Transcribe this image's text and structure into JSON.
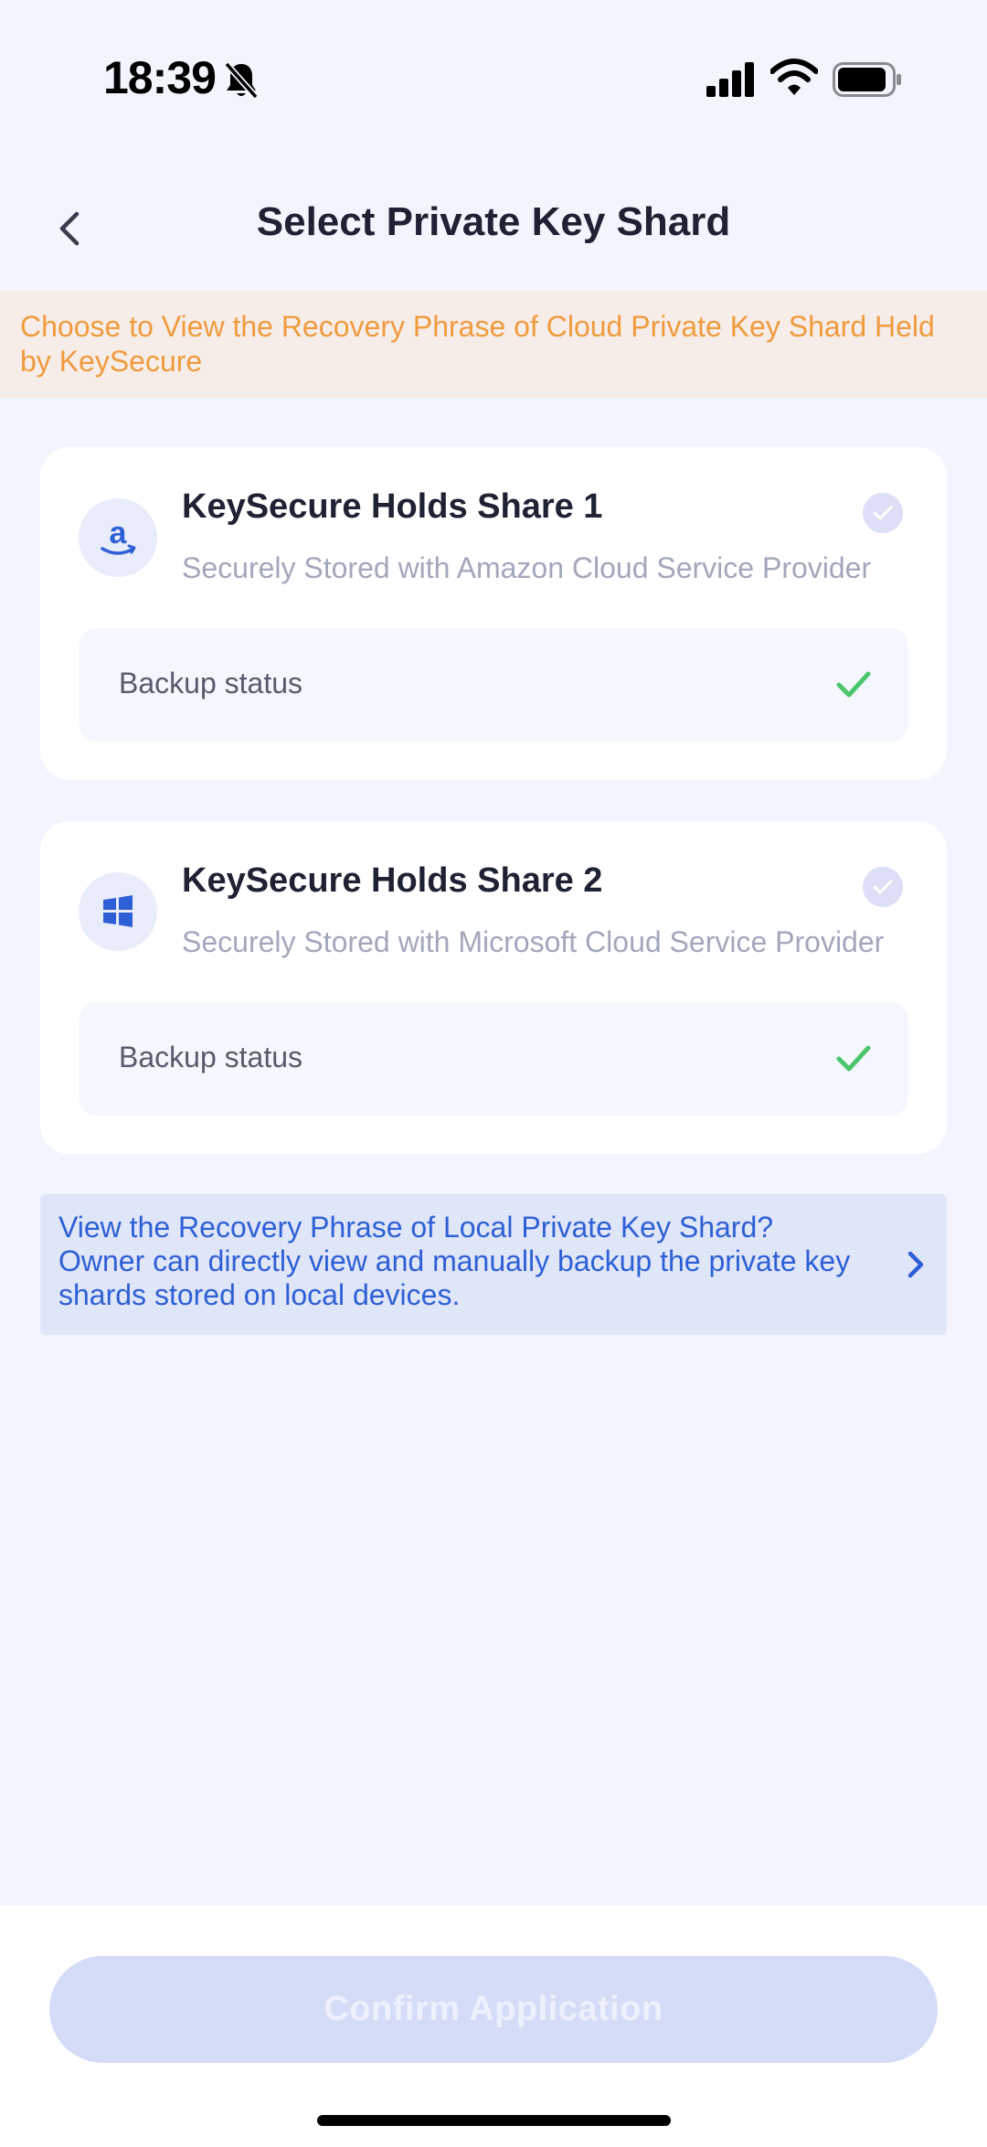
{
  "status_bar": {
    "time": "18:39",
    "icons": [
      "bell-slash-icon",
      "signal-icon",
      "wifi-icon",
      "battery-icon"
    ]
  },
  "header": {
    "title": "Select Private Key Shard",
    "back_icon": "chevron-left-icon"
  },
  "notice": {
    "text": "Choose to View the Recovery Phrase of Cloud Private Key Shard Held by KeySecure"
  },
  "shards": [
    {
      "title": "KeySecure Holds Share 1",
      "subtitle": "Securely Stored with Amazon Cloud Service Provider",
      "logo": "amazon-logo",
      "backup_label": "Backup status",
      "backup_ok": true
    },
    {
      "title": "KeySecure Holds Share 2",
      "subtitle": "Securely Stored with Microsoft Cloud Service Provider",
      "logo": "microsoft-logo",
      "backup_label": "Backup status",
      "backup_ok": true
    }
  ],
  "local_shard": {
    "text": "View the Recovery Phrase of Local Private Key Shard? Owner can directly view and manually backup the private key shards stored on local devices."
  },
  "footer": {
    "confirm_label": "Confirm Application"
  },
  "colors": {
    "accent": "#2f5fd6",
    "notice_text": "#ef9b3e",
    "success": "#4cc66b",
    "disabled_button": "#d5dcf7"
  }
}
